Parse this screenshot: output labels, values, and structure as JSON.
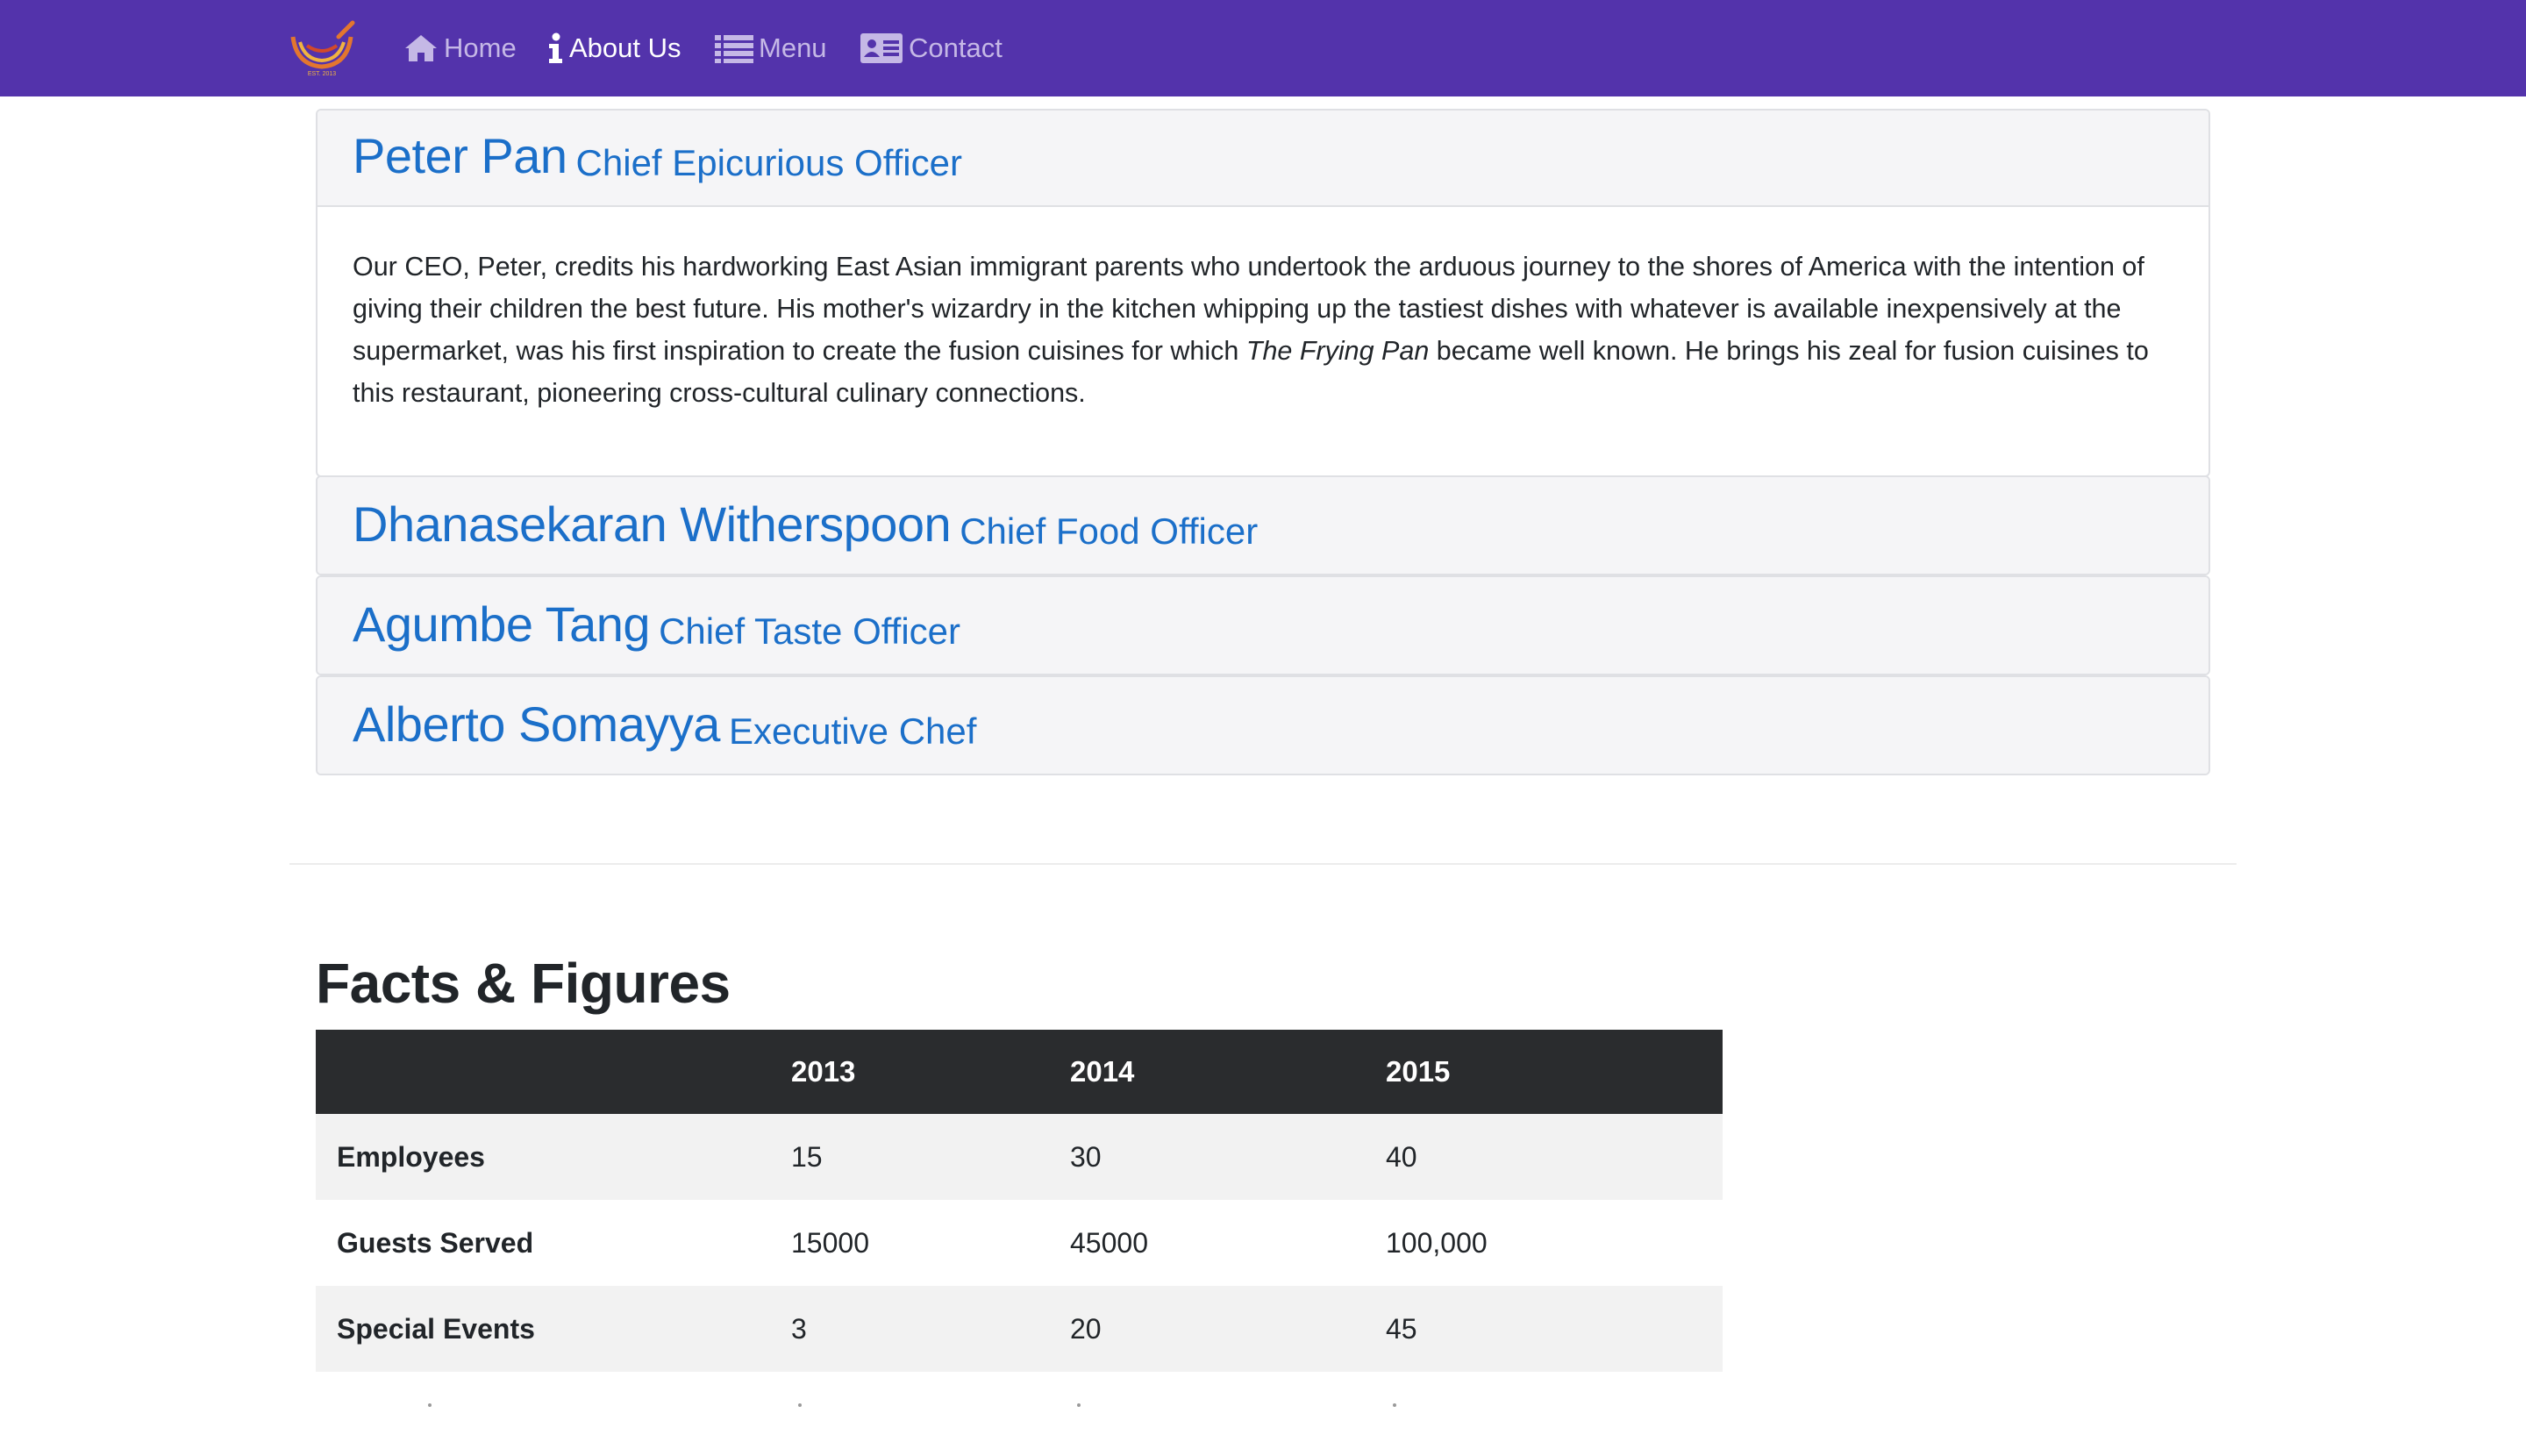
{
  "navbar": {
    "brand_name": "The Frying Pan",
    "items": [
      {
        "label": "Home",
        "icon": "home-icon",
        "active": false
      },
      {
        "label": "About Us",
        "icon": "info-icon",
        "active": true
      },
      {
        "label": "Menu",
        "icon": "list-icon",
        "active": false
      },
      {
        "label": "Contact",
        "icon": "address-card-icon",
        "active": false
      }
    ],
    "colors": {
      "background": "#5333ab",
      "text": "#c5b8e6",
      "active_text": "#ffffff"
    }
  },
  "leadership": [
    {
      "name": "Peter Pan",
      "role": "Chief Epicurious Officer",
      "expanded": true,
      "bio_part1": "Our CEO, Peter, credits his hardworking East Asian immigrant parents who undertook the arduous journey to the shores of America with the intention of giving their children the best future. His mother's wizardry in the kitchen whipping up the tastiest dishes with whatever is available inexpensively at the supermarket, was his first inspiration to create the fusion cuisines for which ",
      "bio_emphasis": "The Frying Pan",
      "bio_part2": " became well known. He brings his zeal for fusion cuisines to this restaurant, pioneering cross-cultural culinary connections."
    },
    {
      "name": "Dhanasekaran Witherspoon",
      "role": "Chief Food Officer",
      "expanded": false
    },
    {
      "name": "Agumbe Tang",
      "role": "Chief Taste Officer",
      "expanded": false
    },
    {
      "name": "Alberto Somayya",
      "role": "Executive Chef",
      "expanded": false
    }
  ],
  "facts": {
    "title": "Facts & Figures",
    "columns": [
      "",
      "2013",
      "2014",
      "2015"
    ],
    "rows": [
      {
        "label": "Employees",
        "values": [
          "15",
          "30",
          "40"
        ]
      },
      {
        "label": "Guests Served",
        "values": [
          "15000",
          "45000",
          "100,000"
        ]
      },
      {
        "label": "Special Events",
        "values": [
          "3",
          "20",
          "45"
        ]
      }
    ]
  },
  "colors": {
    "link_blue": "#1b6fc9",
    "table_header": "#2a2c2e",
    "stripe": "#f2f2f2"
  }
}
